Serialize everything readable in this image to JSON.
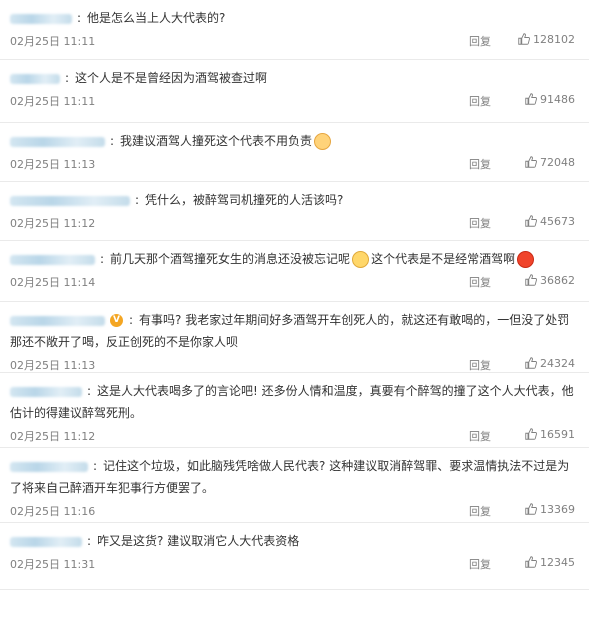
{
  "comments": [
    {
      "text": "他是怎么当上人大代表的?",
      "time": "02月25日 11:11",
      "reply": "回复",
      "likes": "128102",
      "emoji": "",
      "text2": "",
      "vip": false,
      "user_w": 62
    },
    {
      "text": "这个人是不是曾经因为酒驾被查过啊",
      "time": "02月25日 11:11",
      "reply": "回复",
      "likes": "91486",
      "emoji": "",
      "text2": "",
      "vip": false,
      "user_w": 50
    },
    {
      "text": "我建议酒驾人撞死这个代表不用负责",
      "time": "02月25日 11:13",
      "reply": "回复",
      "likes": "72048",
      "emoji": "cat",
      "text2": "",
      "vip": false,
      "user_w": 95
    },
    {
      "text": "凭什么，被醉驾司机撞死的人活该吗?",
      "time": "02月25日 11:12",
      "reply": "回复",
      "likes": "45673",
      "emoji": "",
      "text2": "",
      "vip": false,
      "user_w": 120
    },
    {
      "text": "前几天那个酒驾撞死女生的消息还没被忘记呢",
      "time": "02月25日 11:14",
      "reply": "回复",
      "likes": "36862",
      "emoji": "tear",
      "text2": "这个代表是不是经常酒驾啊",
      "emoji2": "angry",
      "vip": false,
      "user_w": 85
    },
    {
      "text": "有事吗? 我老家过年期间好多酒驾开车创死人的，就这还有敢喝的，一但没了处罚那还不敞开了喝，反正创死的不是你家人呗",
      "time": "02月25日 11:13",
      "reply": "回复",
      "likes": "24324",
      "emoji": "",
      "text2": "",
      "vip": true,
      "user_w": 95
    },
    {
      "text": "这是人大代表喝多了的言论吧! 还多份人情和温度，真要有个醉驾的撞了这个人大代表，他估计的得建议醉驾死刑。",
      "time": "02月25日 11:12",
      "reply": "回复",
      "likes": "16591",
      "emoji": "",
      "text2": "",
      "vip": false,
      "user_w": 72
    },
    {
      "text": "记住这个垃圾，如此脑残凭啥做人民代表? 这种建议取消醉驾罪、要求温情执法不过是为了将来自己醉酒开车犯事行方便罢了。",
      "time": "02月25日 11:16",
      "reply": "回复",
      "likes": "13369",
      "emoji": "",
      "text2": "",
      "vip": false,
      "user_w": 78
    },
    {
      "text": "咋又是这货? 建议取消它人大代表资格",
      "time": "02月25日 11:31",
      "reply": "回复",
      "likes": "12345",
      "emoji": "",
      "text2": "",
      "vip": false,
      "user_w": 72
    }
  ]
}
